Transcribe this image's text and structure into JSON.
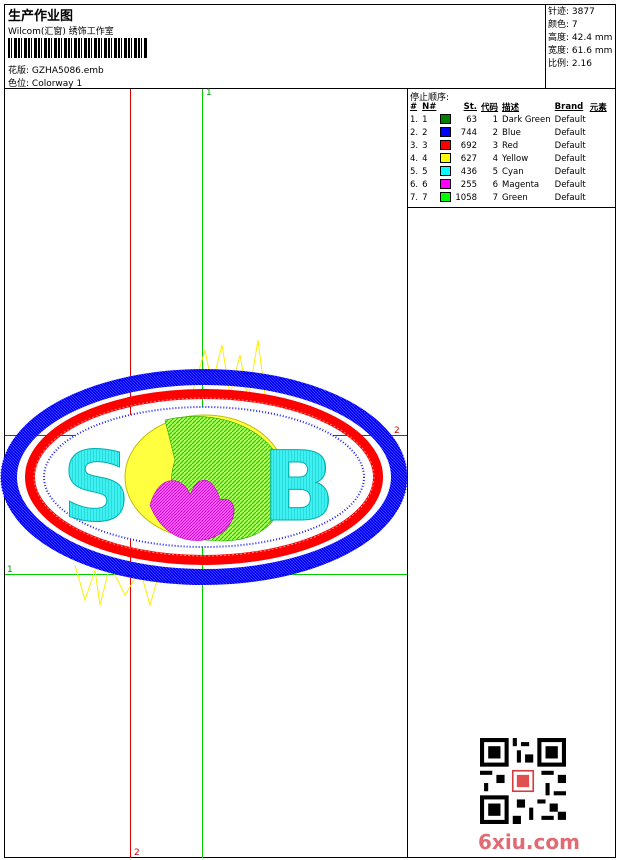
{
  "header": {
    "title": "生产作业图",
    "company": "Wilcom(汇窗) 绣饰工作室",
    "design_label": "花版:",
    "design_value": "GZHA5086.emb",
    "colorway_label": "色位:",
    "colorway_value": "Colorway 1"
  },
  "stats": [
    {
      "label": "针迹:",
      "value": "3877"
    },
    {
      "label": "颜色:",
      "value": "7"
    },
    {
      "label": "高度:",
      "value": "42.4 mm"
    },
    {
      "label": "宽度:",
      "value": "61.6 mm"
    },
    {
      "label": "比例:",
      "value": "2.16"
    }
  ],
  "stop_sequence": {
    "title": "停止顺序:",
    "headers": [
      "#",
      "N#",
      "St.",
      "代码",
      "描述",
      "Brand",
      "元素"
    ],
    "rows": [
      {
        "num": "1.",
        "n": "1",
        "color": "#008000",
        "st": "63",
        "code": "1",
        "desc": "Dark Green",
        "brand": "Default"
      },
      {
        "num": "2.",
        "n": "2",
        "color": "#0000ff",
        "st": "744",
        "code": "2",
        "desc": "Blue",
        "brand": "Default"
      },
      {
        "num": "3.",
        "n": "3",
        "color": "#ff0000",
        "st": "692",
        "code": "3",
        "desc": "Red",
        "brand": "Default"
      },
      {
        "num": "4.",
        "n": "4",
        "color": "#ffff00",
        "st": "627",
        "code": "4",
        "desc": "Yellow",
        "brand": "Default"
      },
      {
        "num": "5.",
        "n": "5",
        "color": "#00ffff",
        "st": "436",
        "code": "5",
        "desc": "Cyan",
        "brand": "Default"
      },
      {
        "num": "6.",
        "n": "6",
        "color": "#ff00ff",
        "st": "255",
        "code": "6",
        "desc": "Magenta",
        "brand": "Default"
      },
      {
        "num": "7.",
        "n": "7",
        "color": "#00ff00",
        "st": "1058",
        "code": "7",
        "desc": "Green",
        "brand": "Default"
      }
    ]
  },
  "guides": {
    "green_v": "1",
    "red_h": "2",
    "green_h": "1",
    "red_v": "2"
  },
  "design_text": {
    "left": "S",
    "right": "B"
  },
  "watermark": "6xiu.com"
}
